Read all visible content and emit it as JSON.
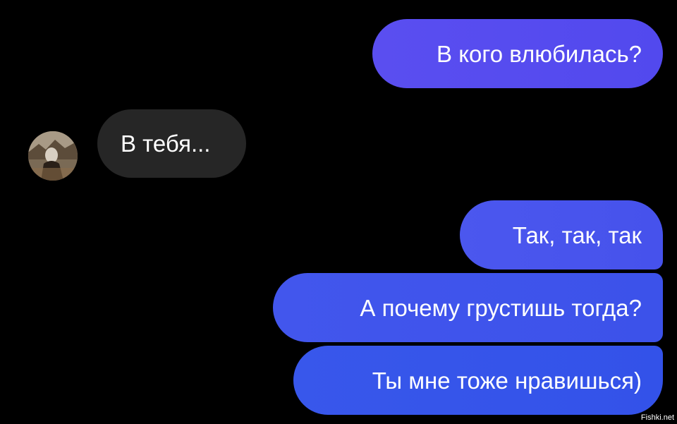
{
  "chat": {
    "messages": [
      {
        "sender": "me",
        "text": "В кого влюбилась?"
      },
      {
        "sender": "them",
        "text": "В тебя..."
      },
      {
        "sender": "me",
        "text": "Так, так, так"
      },
      {
        "sender": "me",
        "text": "А почему грустишь тогда?"
      },
      {
        "sender": "me",
        "text": "Ты мне тоже нравишься)"
      }
    ]
  },
  "colors": {
    "background": "#000000",
    "outgoing_bubble": "#4a55ed",
    "incoming_bubble": "#262626",
    "text": "#ffffff"
  },
  "icons": {
    "avatar": "avatar"
  },
  "watermark": {
    "text": "Fishki.net"
  }
}
